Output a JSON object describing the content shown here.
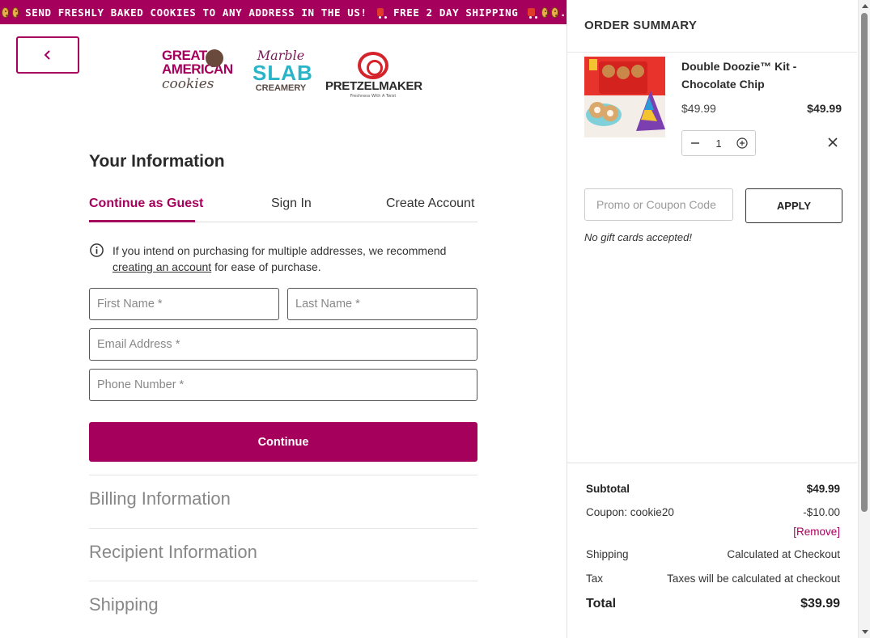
{
  "banner": {
    "text": "SEND FRESHLY BAKED COOKIES TO ANY ADDRESS IN THE US!",
    "shipping_text": "FREE 2 DAY SHIPPING"
  },
  "header": {
    "logos": {
      "great_american_cookies": [
        "GREAT",
        "AMERICAN",
        "cookies"
      ],
      "marble_slab": [
        "Marble",
        "SLAB",
        "CREAMERY"
      ],
      "pretzelmaker": {
        "name": "PRETZELMAKER",
        "tagline": "Freshness With A Twist"
      }
    }
  },
  "your_information": {
    "title": "Your Information",
    "tabs": [
      {
        "label": "Continue as Guest",
        "active": true
      },
      {
        "label": "Sign In",
        "active": false
      },
      {
        "label": "Create Account",
        "active": false
      }
    ],
    "notice": {
      "prefix": "If you intend on purchasing for multiple addresses, we recommend",
      "link": "creating an account",
      "suffix": "for ease of purchase."
    },
    "fields": {
      "first_name": "First Name *",
      "last_name": "Last Name *",
      "email": "Email Address *",
      "phone": "Phone Number *"
    },
    "continue_label": "Continue"
  },
  "sections": [
    "Billing Information",
    "Recipient Information",
    "Shipping"
  ],
  "summary": {
    "title": "ORDER SUMMARY",
    "item": {
      "name": "Double Doozie™ Kit - Chocolate Chip",
      "unit_price": "$49.99",
      "line_total": "$49.99",
      "quantity": "1"
    },
    "promo_placeholder": "Promo or Coupon Code",
    "apply_label": "APPLY",
    "gift_note": "No gift cards accepted!",
    "totals": {
      "subtotal_label": "Subtotal",
      "subtotal": "$49.99",
      "coupon_label": "Coupon: cookie20",
      "coupon_value": "-$10.00",
      "remove_label": "[Remove]",
      "shipping_label": "Shipping",
      "shipping_value": "Calculated at Checkout",
      "tax_label": "Tax",
      "tax_value": "Taxes will be calculated at checkout",
      "total_label": "Total",
      "total": "$39.99"
    }
  },
  "colors": {
    "brand": "#a6005d",
    "marble_slab_teal": "#29b5c7",
    "pretzelmaker_red": "#d4232a"
  }
}
